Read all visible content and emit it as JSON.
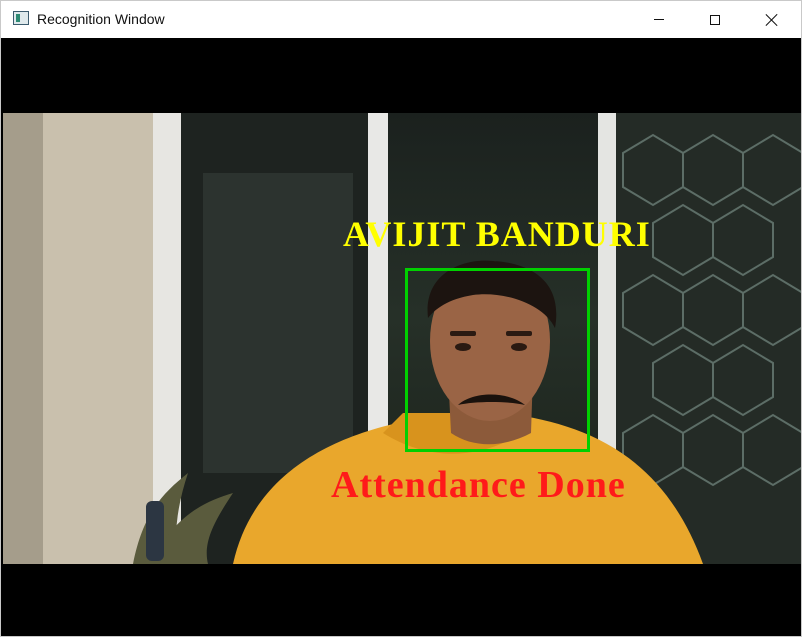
{
  "window": {
    "title": "Recognition Window",
    "controls": [
      "minimize",
      "maximize",
      "close"
    ]
  },
  "overlay": {
    "name_label": "AVIJIT BANDURI",
    "status_label": "Attendance Done",
    "name_color": "#ffff00",
    "status_color": "#ff1a1a",
    "face_box_color": "#00d000"
  },
  "icons": [
    "app-icon",
    "minimize-icon",
    "maximize-icon",
    "close-icon"
  ]
}
